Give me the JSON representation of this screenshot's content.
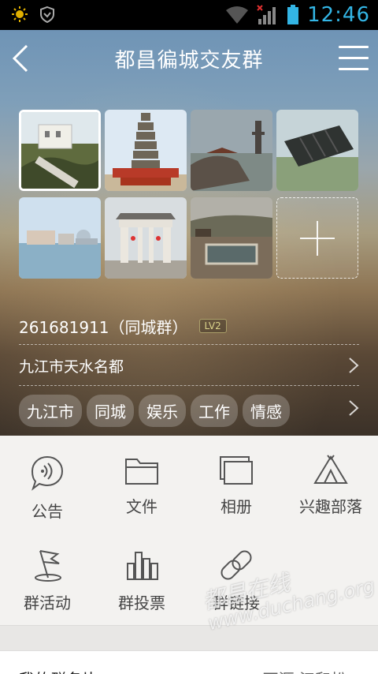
{
  "status_bar": {
    "time": "12:46",
    "icons": [
      "sun-icon",
      "shield-icon",
      "wifi-icon",
      "signal-icon",
      "battery-icon"
    ]
  },
  "header": {
    "title": "都昌徧城交友群",
    "back_icon": "back-chevron-icon",
    "menu_icon": "menu-icon"
  },
  "gallery": {
    "photos": [
      {
        "name": "hillside-building",
        "selected": true
      },
      {
        "name": "pagoda"
      },
      {
        "name": "lakeside-pagoda"
      },
      {
        "name": "stone-scroll-monument"
      },
      {
        "name": "waterfront-city"
      },
      {
        "name": "memorial-archway"
      },
      {
        "name": "riverside-park"
      }
    ],
    "add_icon": "plus-icon"
  },
  "group": {
    "id_text": "261681911（同城群）",
    "level": "LV2",
    "location": "九江市天水名都",
    "tags": [
      "九江市",
      "同城",
      "娱乐",
      "工作",
      "情感"
    ]
  },
  "functions": [
    {
      "label": "公告",
      "icon": "announcement-icon"
    },
    {
      "label": "文件",
      "icon": "folder-icon"
    },
    {
      "label": "相册",
      "icon": "album-icon"
    },
    {
      "label": "兴趣部落",
      "icon": "tent-icon"
    },
    {
      "label": "群活动",
      "icon": "flag-icon"
    },
    {
      "label": "群投票",
      "icon": "bar-chart-icon"
    },
    {
      "label": "群链接",
      "icon": "link-icon"
    }
  ],
  "card": {
    "label": "我的群名片",
    "value": "西源 江和松"
  },
  "watermark": {
    "cn": "都昌在线",
    "url": "www.duchang.org"
  },
  "colors": {
    "status_accent": "#33b5e5",
    "level_badge": "#dcd48a"
  }
}
